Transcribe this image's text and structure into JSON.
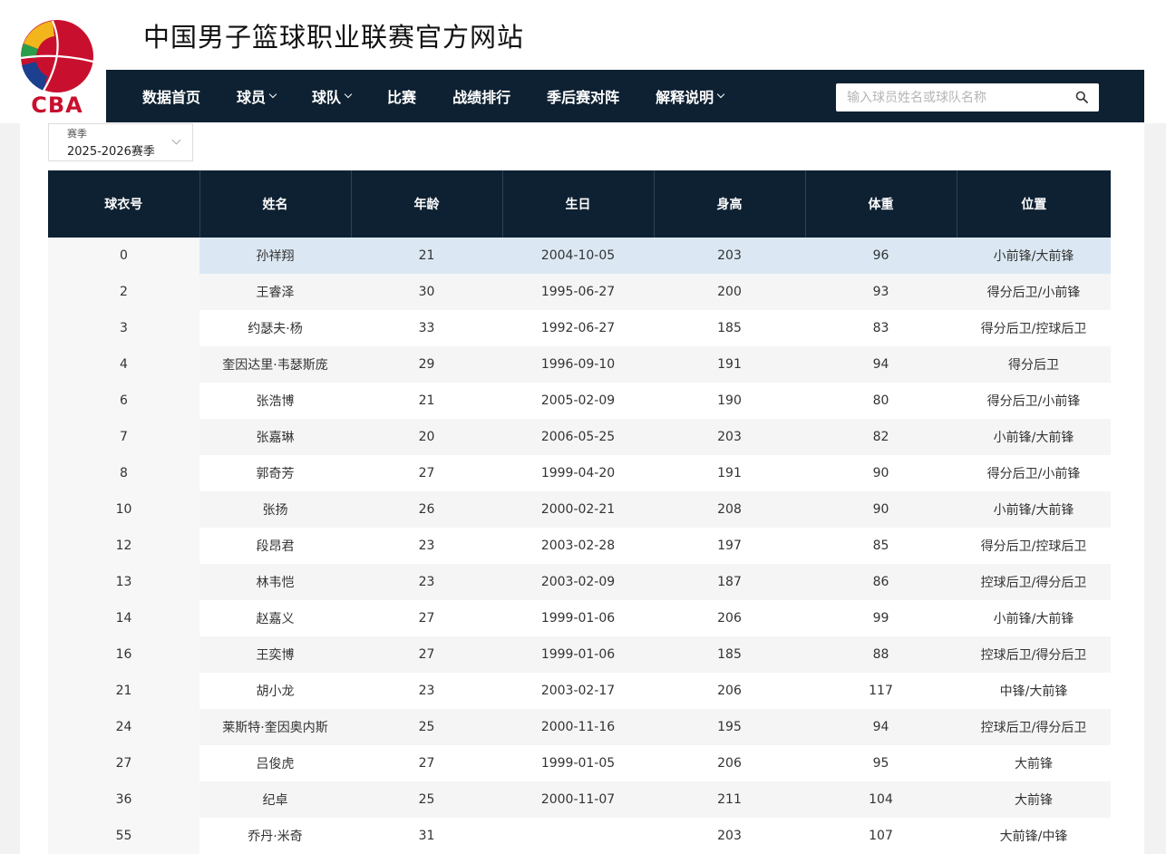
{
  "site": {
    "title": "中国男子篮球职业联赛官方网站",
    "logo_text": "CBA"
  },
  "nav": {
    "items": [
      {
        "label": "数据首页",
        "dropdown": false
      },
      {
        "label": "球员",
        "dropdown": true
      },
      {
        "label": "球队",
        "dropdown": true
      },
      {
        "label": "比赛",
        "dropdown": false
      },
      {
        "label": "战绩排行",
        "dropdown": false
      },
      {
        "label": "季后赛对阵",
        "dropdown": false
      },
      {
        "label": "解释说明",
        "dropdown": true
      }
    ]
  },
  "search": {
    "placeholder": "输入球员姓名或球队名称",
    "value": "",
    "icon": "search-icon"
  },
  "season": {
    "label": "赛季",
    "value": "2025-2026赛季"
  },
  "table": {
    "headers": [
      "球衣号",
      "姓名",
      "年龄",
      "生日",
      "身高",
      "体重",
      "位置"
    ],
    "rows": [
      [
        "0",
        "孙祥翔",
        "21",
        "2004-10-05",
        "203",
        "96",
        "小前锋/大前锋"
      ],
      [
        "2",
        "王睿泽",
        "30",
        "1995-06-27",
        "200",
        "93",
        "得分后卫/小前锋"
      ],
      [
        "3",
        "约瑟夫·杨",
        "33",
        "1992-06-27",
        "185",
        "83",
        "得分后卫/控球后卫"
      ],
      [
        "4",
        "奎因达里·韦瑟斯庞",
        "29",
        "1996-09-10",
        "191",
        "94",
        "得分后卫"
      ],
      [
        "6",
        "张浩博",
        "21",
        "2005-02-09",
        "190",
        "80",
        "得分后卫/小前锋"
      ],
      [
        "7",
        "张嘉琳",
        "20",
        "2006-05-25",
        "203",
        "82",
        "小前锋/大前锋"
      ],
      [
        "8",
        "郭奇芳",
        "27",
        "1999-04-20",
        "191",
        "90",
        "得分后卫/小前锋"
      ],
      [
        "10",
        "张扬",
        "26",
        "2000-02-21",
        "208",
        "90",
        "小前锋/大前锋"
      ],
      [
        "12",
        "段昂君",
        "23",
        "2003-02-28",
        "197",
        "85",
        "得分后卫/控球后卫"
      ],
      [
        "13",
        "林韦恺",
        "23",
        "2003-02-09",
        "187",
        "86",
        "控球后卫/得分后卫"
      ],
      [
        "14",
        "赵嘉义",
        "27",
        "1999-01-06",
        "206",
        "99",
        "小前锋/大前锋"
      ],
      [
        "16",
        "王奕博",
        "27",
        "1999-01-06",
        "185",
        "88",
        "控球后卫/得分后卫"
      ],
      [
        "21",
        "胡小龙",
        "23",
        "2003-02-17",
        "206",
        "117",
        "中锋/大前锋"
      ],
      [
        "24",
        "莱斯特·奎因奥内斯",
        "25",
        "2000-11-16",
        "195",
        "94",
        "控球后卫/得分后卫"
      ],
      [
        "27",
        "吕俊虎",
        "27",
        "1999-01-05",
        "206",
        "95",
        "大前锋"
      ],
      [
        "36",
        "纪卓",
        "25",
        "2000-11-07",
        "211",
        "104",
        "大前锋"
      ],
      [
        "55",
        "乔丹·米奇",
        "31",
        "",
        "203",
        "107",
        "大前锋/中锋"
      ]
    ],
    "highlighted_row": 0
  },
  "colors": {
    "nav_bg": "#0e2132",
    "highlight_row": "#dbe8f3",
    "logo_red": "#c8102e",
    "logo_blue": "#1d3f8f",
    "logo_yellow": "#f2b51b",
    "logo_green": "#2a9d4a"
  }
}
